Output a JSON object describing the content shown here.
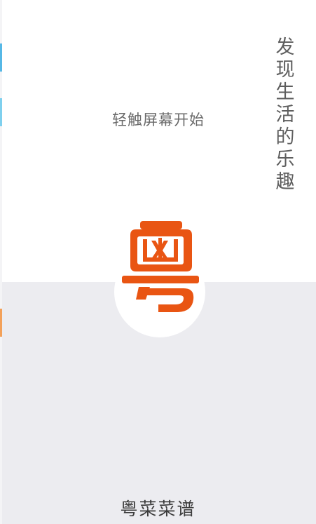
{
  "splash": {
    "tap_hint": "轻触屏幕开始",
    "slogan": "发现生活的乐趣",
    "app_name": "粤菜菜谱",
    "logo_char": "粤"
  },
  "colors": {
    "logo_orange": "#e95513",
    "bottom_background": "#ececf0",
    "top_background": "#ffffff"
  },
  "icons": {
    "logo": "yue-character-logo"
  }
}
